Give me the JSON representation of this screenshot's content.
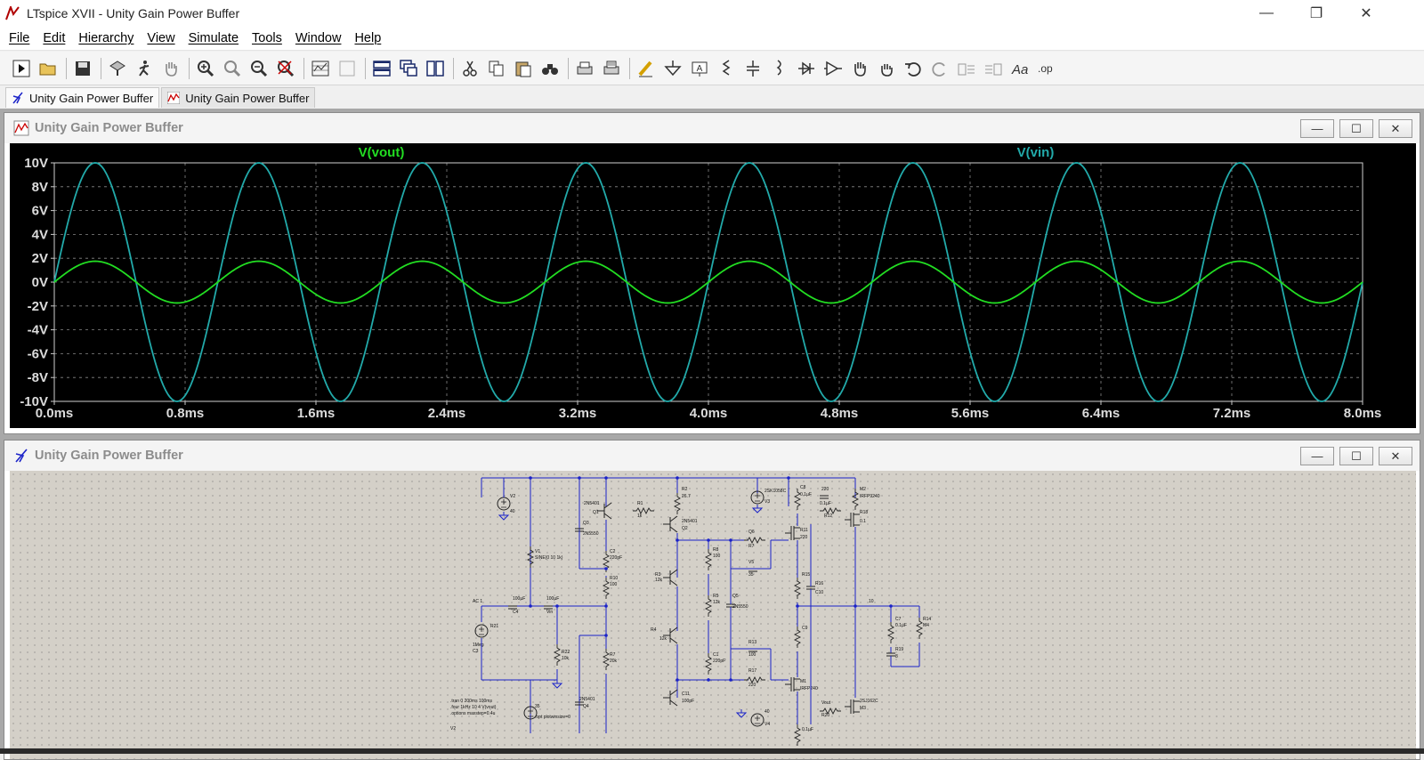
{
  "window": {
    "title": "LTspice XVII - Unity Gain Power Buffer"
  },
  "window_controls": {
    "minimize": "—",
    "restore": "❐",
    "close": "✕"
  },
  "menu": [
    "File",
    "Edit",
    "Hierarchy",
    "View",
    "Simulate",
    "Tools",
    "Window",
    "Help"
  ],
  "toolbar_icons": [
    "run-icon",
    "open-icon",
    "save-icon",
    "control-panel-icon",
    "halt-icon",
    "pan-icon",
    "zoom-in-icon",
    "zoom-area-icon",
    "zoom-out-icon",
    "zoom-fit-icon",
    "autorange-icon",
    "unused-icon",
    "tile-horizontal-icon",
    "cascade-icon",
    "tile-vertical-icon",
    "cut-icon",
    "copy-icon",
    "paste-icon",
    "find-icon",
    "print-icon",
    "print-setup-icon",
    "draw-wire-icon",
    "ground-icon",
    "label-net-icon",
    "resistor-icon",
    "capacitor-icon",
    "inductor-icon",
    "diode-icon",
    "component-icon",
    "move-icon",
    "drag-icon",
    "undo-icon",
    "redo-icon",
    "rotate-icon",
    "mirror-icon",
    "text-icon",
    "spice-directive-icon"
  ],
  "tabs": [
    {
      "label": "Unity Gain Power Buffer",
      "type": "schematic"
    },
    {
      "label": "Unity Gain Power Buffer",
      "type": "waveform"
    }
  ],
  "plot_window": {
    "title": "Unity Gain Power Buffer",
    "buttons": [
      "—",
      "☐",
      "✕"
    ]
  },
  "schematic_window": {
    "title": "Unity Gain Power Buffer",
    "buttons": [
      "—",
      "☐",
      "✕"
    ]
  },
  "colors": {
    "vout": "#22dd22",
    "vin": "#22aaaa",
    "grid": "#888888",
    "plot_bg": "#000000",
    "wire": "#1a22c8"
  },
  "chart_data": {
    "type": "line",
    "xlabel": "",
    "ylabel": "",
    "x_ticks": [
      "0.0ms",
      "0.8ms",
      "1.6ms",
      "2.4ms",
      "3.2ms",
      "4.0ms",
      "4.8ms",
      "5.6ms",
      "6.4ms",
      "7.2ms",
      "8.0ms"
    ],
    "y_ticks": [
      "10V",
      "8V",
      "6V",
      "4V",
      "2V",
      "0V",
      "-2V",
      "-4V",
      "-6V",
      "-8V",
      "-10V"
    ],
    "xlim_ms": [
      0,
      8
    ],
    "ylim_V": [
      -10,
      10
    ],
    "grid": true,
    "series": [
      {
        "name": "V(vout)",
        "amplitude_V": 1.75,
        "frequency_Hz": 1000,
        "phase": "sine"
      },
      {
        "name": "V(vin)",
        "amplitude_V": 10,
        "frequency_Hz": 1000,
        "phase": "sine"
      }
    ]
  },
  "schematic": {
    "labels": [
      "V2",
      "40",
      "V1",
      "SINE(0 10 1k)",
      "AC 1",
      "R21",
      "1Meg",
      "C3",
      "100µF",
      "C4",
      "100µF",
      "Vin",
      "R22",
      "10k",
      "2N5401",
      "Q1",
      "R1",
      "1k",
      "R2",
      "26.7",
      "2N5401",
      "Q2",
      "C2",
      "220pF",
      "R10",
      "100",
      "R7",
      "20k",
      "Q3",
      "2N5550",
      "R3",
      "12k",
      "R4",
      "12k",
      "C11",
      "100pF",
      "2N5401",
      "Q4",
      "R8",
      "100",
      "R5",
      "12k",
      "C1",
      "220pF",
      "Q5",
      "2N5550",
      "Q6",
      "R7",
      "V5",
      "35",
      "R13",
      "100",
      "R17",
      "220",
      "R11",
      "220",
      "M1",
      "IRFP240",
      "C8",
      "0.1µF",
      "R15",
      "C9",
      "0.1µF",
      "R16",
      "C10",
      "0.1µF",
      "R12",
      "220",
      "M2",
      "IRFP9240",
      "R18",
      "0.1",
      "2SJ162C",
      "M3",
      "Vout",
      "R20",
      "10",
      "C7",
      "0.1µF",
      "R19",
      "8",
      "R14",
      "M4",
      "2SK1058C",
      "V3",
      "40",
      "V4",
      "35",
      ".opt plotwinsize=0",
      ".tran 0 200ms 100ms",
      ".four 1kHz 10 4 V(vout)",
      ".options maxstep=0.4u"
    ]
  }
}
